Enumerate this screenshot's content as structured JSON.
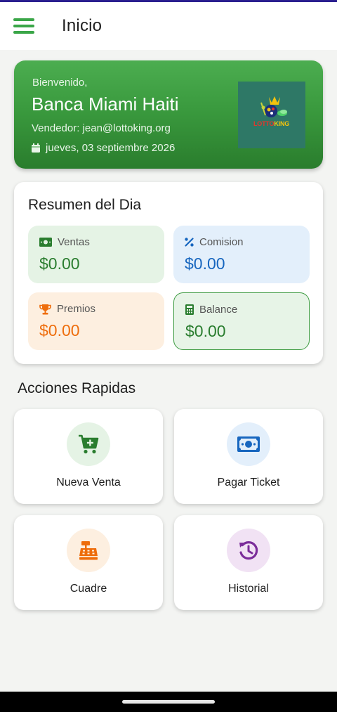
{
  "app_bar": {
    "title": "Inicio"
  },
  "welcome": {
    "greeting": "Bienvenido,",
    "bank_name": "Banca Miami Haiti",
    "vendor": "Vendedor: jean@lottoking.org",
    "date": "jueves, 03 septiembre 2026",
    "logo_text_part1": "LOTTO",
    "logo_text_part2": "KING"
  },
  "summary": {
    "title": "Resumen del Dia",
    "stats": [
      {
        "label": "Ventas",
        "value": "$0.00",
        "icon": "money-bill-icon",
        "color": "#2a7d2f"
      },
      {
        "label": "Comision",
        "value": "$0.00",
        "icon": "percent-icon",
        "color": "#1766bf"
      },
      {
        "label": "Premios",
        "value": "$0.00",
        "icon": "trophy-icon",
        "color": "#ee6d0c"
      },
      {
        "label": "Balance",
        "value": "$0.00",
        "icon": "calculator-icon",
        "color": "#2a7d2f"
      }
    ]
  },
  "quick_actions": {
    "title": "Acciones Rapidas",
    "items": [
      {
        "label": "Nueva Venta",
        "icon": "cart-plus-icon",
        "color": "#2a7d2f"
      },
      {
        "label": "Pagar Ticket",
        "icon": "money-bill-icon",
        "color": "#1766bf"
      },
      {
        "label": "Cuadre",
        "icon": "cash-register-icon",
        "color": "#ee6d0c"
      },
      {
        "label": "Historial",
        "icon": "history-icon",
        "color": "#7b2d9a"
      }
    ]
  },
  "colors": {
    "primary": "#3aa648",
    "top_accent": "#2b1f8f"
  }
}
